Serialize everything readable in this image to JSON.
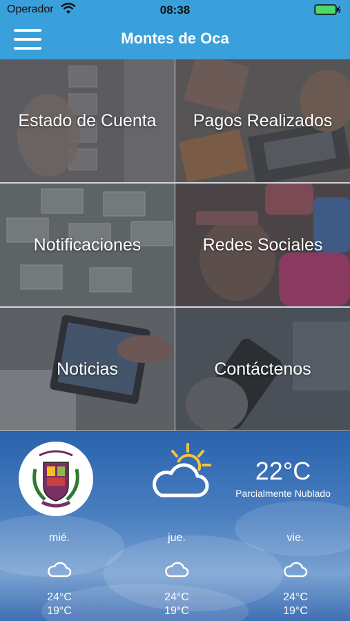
{
  "status_bar": {
    "carrier": "Operador",
    "time": "08:38"
  },
  "header": {
    "title": "Montes de Oca",
    "menu_icon": "hamburger-menu-icon"
  },
  "tiles": [
    {
      "label": "Estado de Cuenta"
    },
    {
      "label": "Pagos Realizados"
    },
    {
      "label": "Notificaciones"
    },
    {
      "label": "Redes Sociales"
    },
    {
      "label": "Noticias"
    },
    {
      "label": "Contáctenos"
    }
  ],
  "weather": {
    "current_temp": "22°C",
    "condition": "Parcialmente Nublado",
    "forecast": [
      {
        "day": "mié.",
        "high": "24°C",
        "low": "19°C"
      },
      {
        "day": "jue.",
        "high": "24°C",
        "low": "19°C"
      },
      {
        "day": "vie.",
        "high": "24°C",
        "low": "19°C"
      }
    ]
  },
  "colors": {
    "accent": "#3aa0dc",
    "weather_bg": "#2a63ad"
  }
}
